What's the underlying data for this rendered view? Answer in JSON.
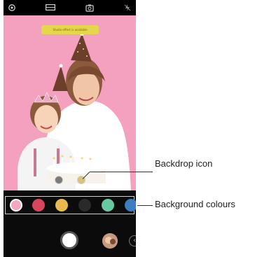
{
  "preview": {
    "toast_text": "Studio effect is available",
    "background_color": "#f4a1bf"
  },
  "status_icons": [
    "gear-icon",
    "aspect-ratio-icon",
    "switch-camera-icon",
    "flash-off-icon"
  ],
  "background_colours": [
    "#f4a7bd",
    "#d9455b",
    "#e9bb4e",
    "#2a2a2a",
    "#67c9a1",
    "#3d7ec2"
  ],
  "callouts": {
    "backdrop": "Backdrop icon",
    "background": "Background colours"
  }
}
